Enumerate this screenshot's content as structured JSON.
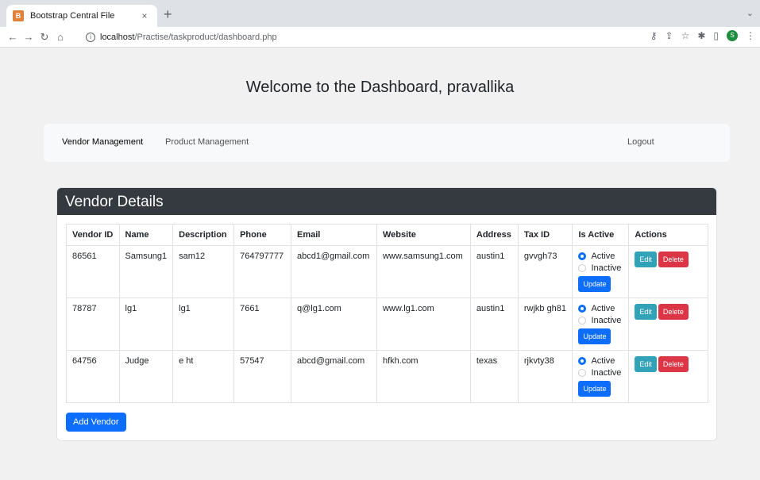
{
  "browser": {
    "tab_title": "Bootstrap Central File",
    "tab_close": "×",
    "new_tab": "+",
    "url_host": "localhost",
    "url_path": "/Practise/taskproduct/dashboard.php",
    "avatar_letter": "S"
  },
  "page": {
    "title": "Welcome to the Dashboard, pravallika"
  },
  "navbar": {
    "items": [
      "Vendor Management",
      "Product Management"
    ],
    "logout": "Logout"
  },
  "card": {
    "title": "Vendor Details",
    "columns": [
      "Vendor ID",
      "Name",
      "Description",
      "Phone",
      "Email",
      "Website",
      "Address",
      "Tax ID",
      "Is Active",
      "Actions"
    ],
    "rows": [
      {
        "id": "86561",
        "name": "Samsung1",
        "description": "sam12",
        "phone": "764797777",
        "email": "abcd1@gmail.com",
        "website": "www.samsung1.com",
        "address": "austin1",
        "tax_id": "gvvgh73"
      },
      {
        "id": "78787",
        "name": "lg1",
        "description": "lg1",
        "phone": "7661",
        "email": "q@lg1.com",
        "website": "www.lg1.com",
        "address": "austin1",
        "tax_id": "rwjkb gh81"
      },
      {
        "id": "64756",
        "name": "Judge",
        "description": "e ht",
        "phone": "57547",
        "email": "abcd@gmail.com",
        "website": "hfkh.com",
        "address": "texas",
        "tax_id": "rjkvty38"
      }
    ],
    "active_label": "Active",
    "inactive_label": "Inactive",
    "update_label": "Update",
    "edit_label": "Edit",
    "delete_label": "Delete",
    "add_label": "Add Vendor"
  }
}
